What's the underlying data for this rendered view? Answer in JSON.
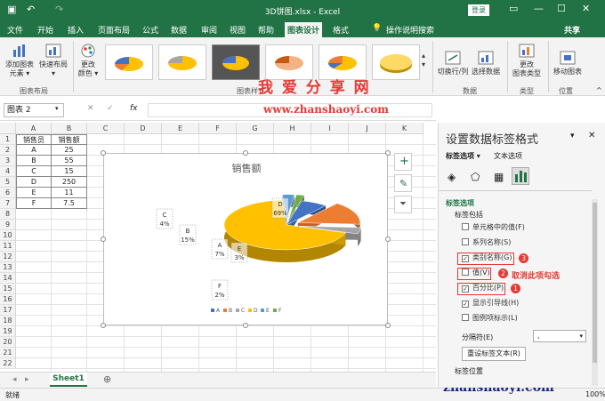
{
  "window": {
    "title": "3D饼图.xlsx  -  Excel",
    "login_label": "登录"
  },
  "tabs": [
    "文件",
    "开始",
    "插入",
    "页面布局",
    "公式",
    "数据",
    "审阅",
    "视图",
    "帮助",
    "图表设计",
    "格式",
    "操作说明搜索",
    "共享"
  ],
  "ribbon": {
    "add_element": "添加图表\n元素 ▾",
    "quick_layout": "快速布局\n▾",
    "change_color": "更改\n颜色 ▾",
    "group_layout": "图表布局",
    "group_styles": "图表样式",
    "switch_rowcol": "切换行/列",
    "select_data": "选择数据",
    "group_data": "数据",
    "change_type": "更改\n图表类型",
    "group_type": "类型",
    "move_chart": "移动图表",
    "group_location": "位置"
  },
  "watermark": {
    "line1": "我 爱 分 享 网",
    "line2": "www.zhanshaoyi.com",
    "corner": "zhanshaoyi.com"
  },
  "formula": {
    "name_box": "图表 2",
    "fx": "fx"
  },
  "columns": [
    "A",
    "B",
    "C",
    "D",
    "E",
    "F",
    "G",
    "H",
    "I",
    "J",
    "K"
  ],
  "rows": [
    "1",
    "2",
    "3",
    "4",
    "5",
    "6",
    "7",
    "8",
    "9",
    "10",
    "11",
    "12",
    "13",
    "14",
    "15",
    "16",
    "17",
    "18",
    "19",
    "20",
    "21",
    "22"
  ],
  "table": {
    "headers": [
      "销售员",
      "销售额"
    ],
    "rows": [
      [
        "A",
        "25"
      ],
      [
        "B",
        "55"
      ],
      [
        "C",
        "15"
      ],
      [
        "D",
        "250"
      ],
      [
        "E",
        "11"
      ],
      [
        "F",
        "7.5"
      ]
    ]
  },
  "chart_data": {
    "type": "pie",
    "title": "销售额",
    "categories": [
      "A",
      "B",
      "C",
      "D",
      "E",
      "F"
    ],
    "values": [
      25,
      55,
      15,
      250,
      11,
      7.5
    ],
    "percent_labels": [
      "7%",
      "15%",
      "4%",
      "69%",
      "3%",
      "2%"
    ],
    "legend_placement": "bottom",
    "colors": [
      "#4472c4",
      "#ed7d31",
      "#a5a5a5",
      "#ffc000",
      "#5b9bd5",
      "#70ad47"
    ]
  },
  "sheet_tab": "Sheet1",
  "status": {
    "left": "就绪",
    "zoom": "100%"
  },
  "pane": {
    "title": "设置数据标签格式",
    "tab1": "标签选项 ▾",
    "tab2": "文本选项",
    "section": "标签选项",
    "contains": "标签包括",
    "opts": [
      "单元格中的值(F)",
      "系列名称(S)",
      "类别名称(G)",
      "值(V)",
      "百分比(P)",
      "显示引导线(H)",
      "图例项标示(L)"
    ],
    "checked": [
      false,
      false,
      true,
      false,
      true,
      true,
      false
    ],
    "annotation": "取消此项勾选",
    "sep_label": "分隔符(E)",
    "sep_value": ",",
    "reset_btn": "重设标签文本(R)",
    "label_pos": "标签位置"
  }
}
